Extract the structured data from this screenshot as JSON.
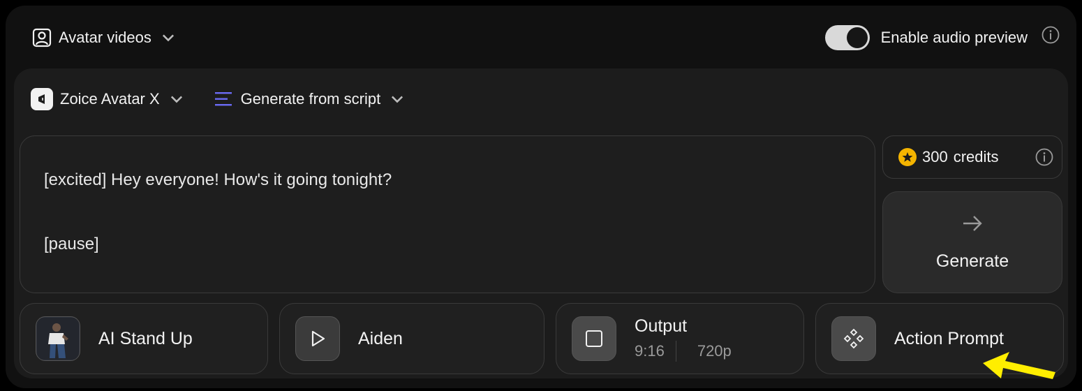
{
  "topbar": {
    "mode_label": "Avatar videos",
    "audio_label": "Enable audio preview",
    "audio_enabled": true
  },
  "selectors": {
    "model_label": "Zoice Avatar X",
    "source_label": "Generate from script"
  },
  "script": {
    "lines": [
      "[excited] Hey everyone! How's it going tonight?",
      "[pause]"
    ]
  },
  "credits": {
    "amount": "300",
    "unit": "credits"
  },
  "generate": {
    "label": "Generate"
  },
  "options": {
    "avatar_label": "AI Stand Up",
    "voice_label": "Aiden",
    "output_label": "Output",
    "output_ratio": "9:16",
    "output_resolution": "720p",
    "action_label": "Action Prompt"
  },
  "colors": {
    "accent_lines": "#6b6bf5",
    "coin": "#f4b400",
    "annotation_arrow": "#ffee00"
  }
}
